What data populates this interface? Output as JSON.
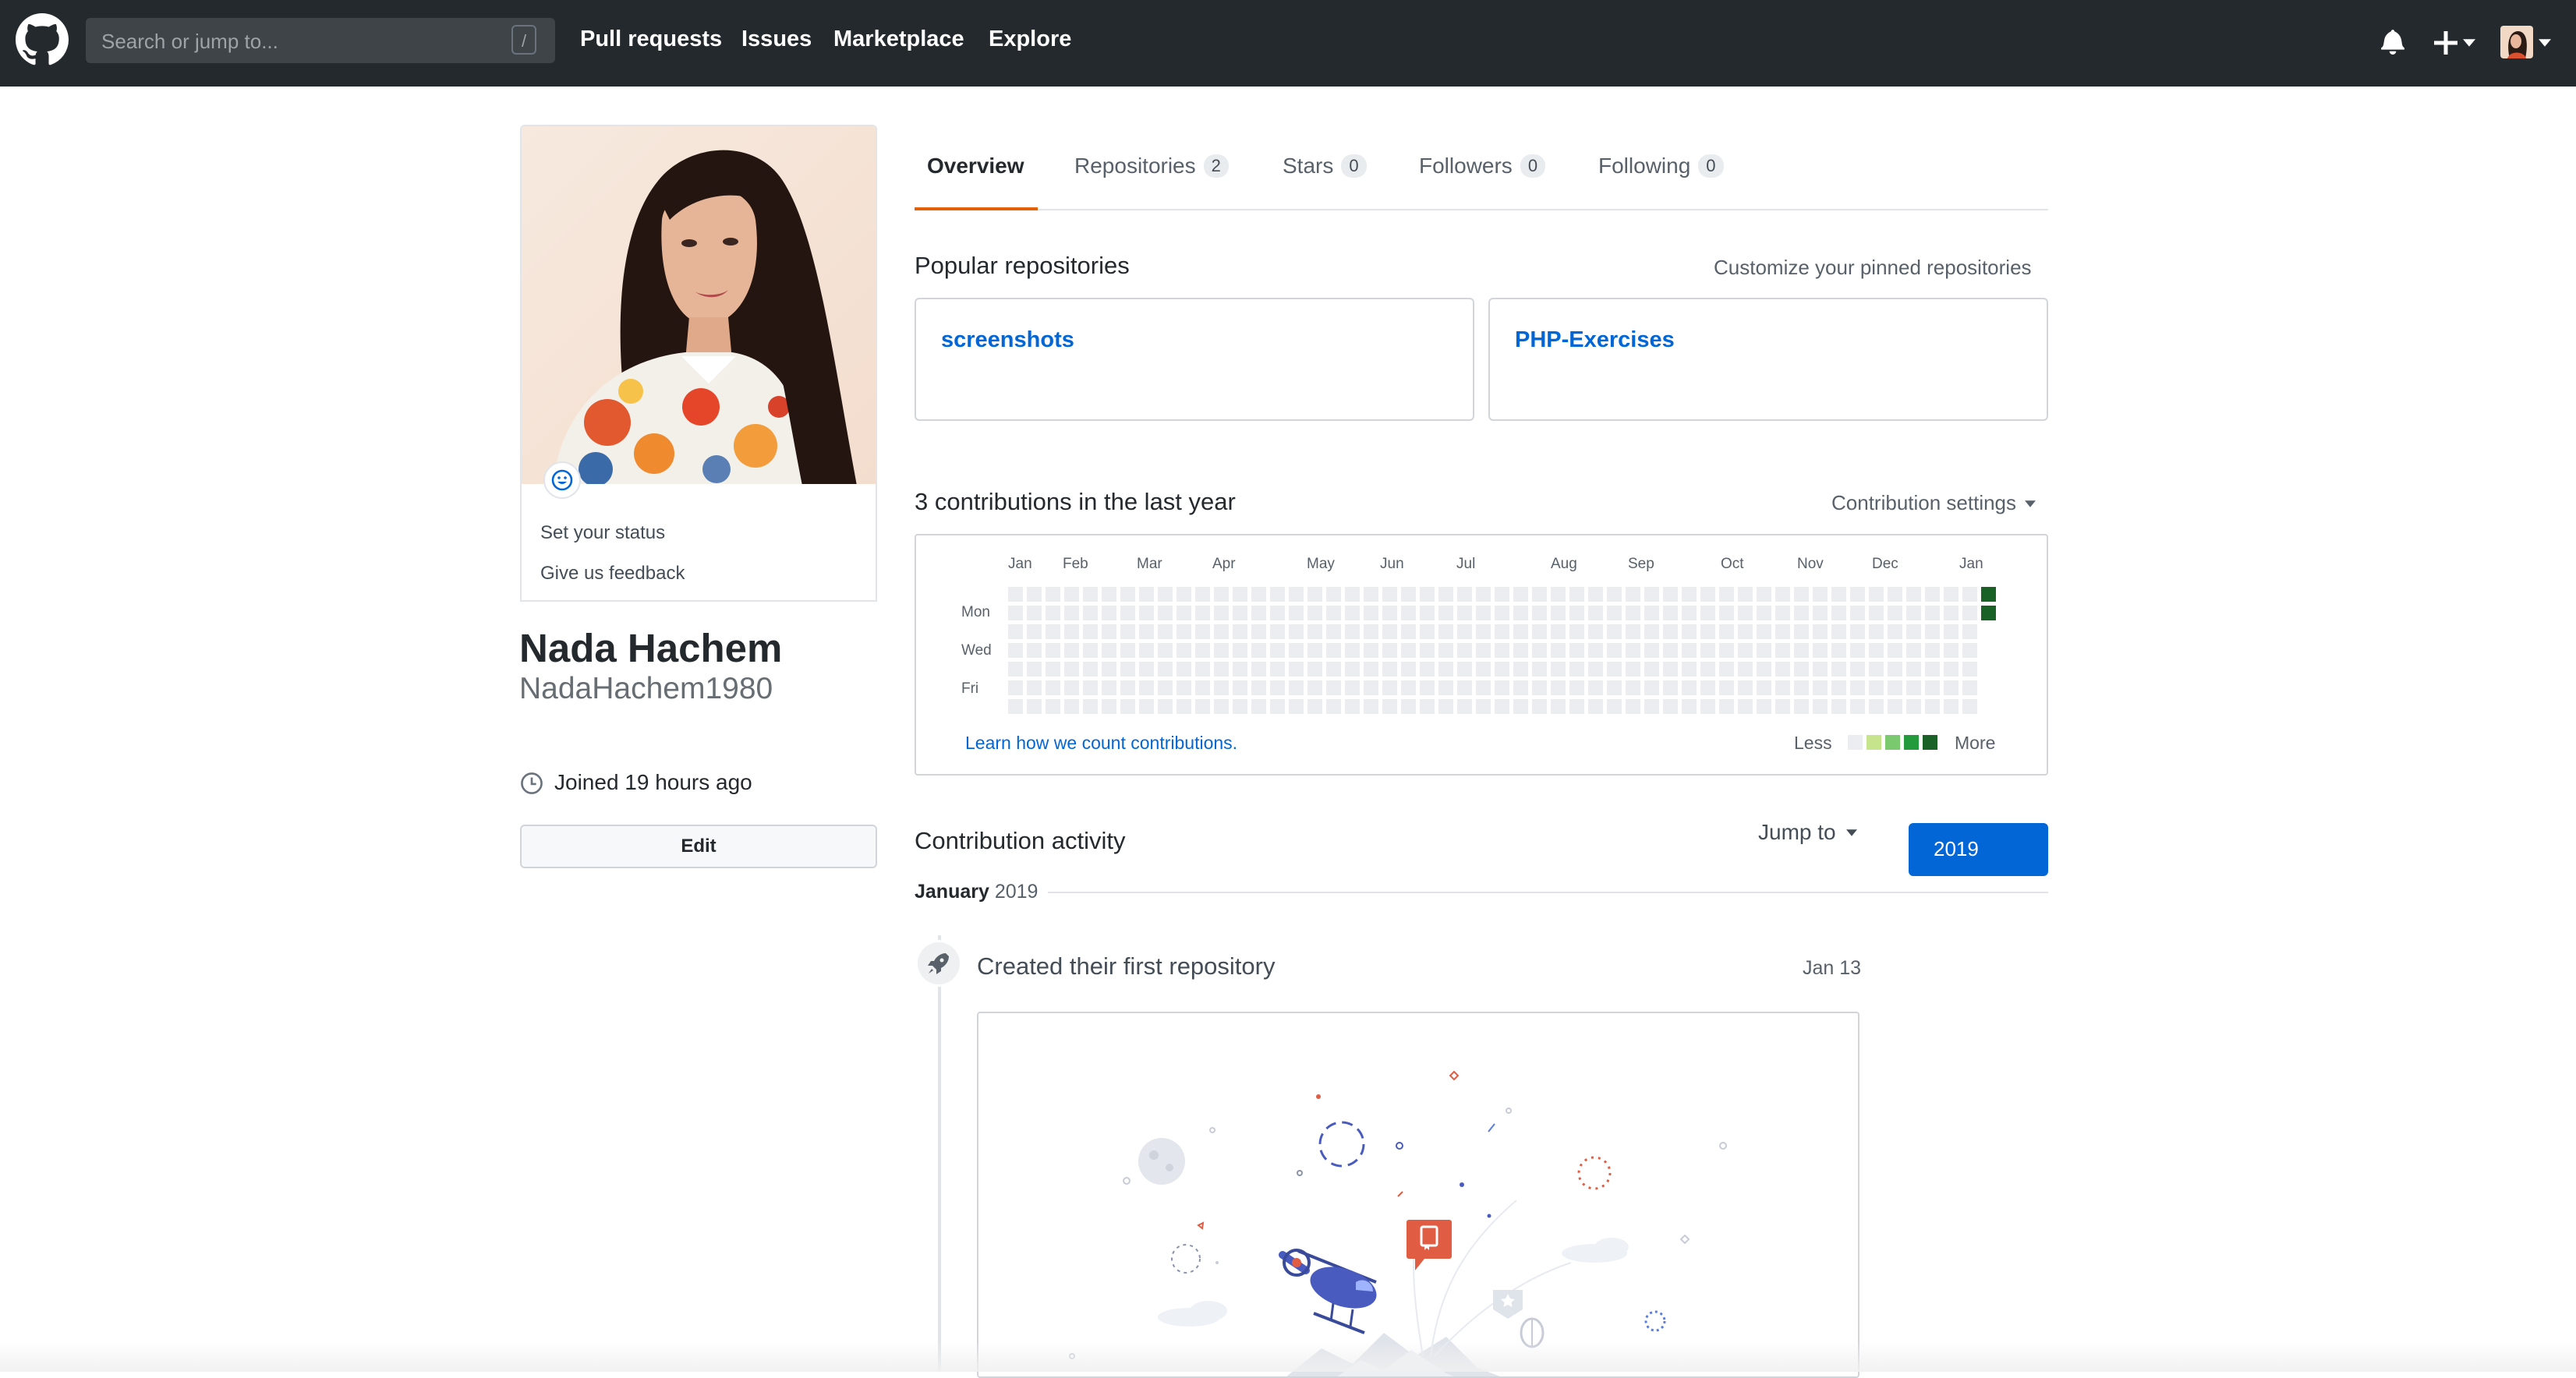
{
  "header": {
    "search_placeholder": "Search or jump to...",
    "search_shortcut": "/",
    "nav": [
      "Pull requests",
      "Issues",
      "Marketplace",
      "Explore"
    ],
    "icons": [
      "github-logo-icon",
      "bell-icon",
      "plus-icon",
      "caret-down-icon",
      "avatar"
    ]
  },
  "sidebar": {
    "status_emoji": "smiley-icon",
    "set_status": "Set your status",
    "give_feedback": "Give us feedback",
    "name": "Nada Hachem",
    "username": "NadaHachem1980",
    "joined": "Joined 19 hours ago",
    "edit_label": "Edit"
  },
  "tabs": [
    {
      "label": "Overview",
      "count": null,
      "selected": true
    },
    {
      "label": "Repositories",
      "count": "2"
    },
    {
      "label": "Stars",
      "count": "0"
    },
    {
      "label": "Followers",
      "count": "0"
    },
    {
      "label": "Following",
      "count": "0"
    }
  ],
  "pinned": {
    "title": "Popular repositories",
    "customize": "Customize your pinned repositories",
    "repos": [
      "screenshots",
      "PHP-Exercises"
    ]
  },
  "contributions": {
    "title": "3 contributions in the last year",
    "settings": "Contribution settings",
    "months": [
      "Jan",
      "Feb",
      "Mar",
      "Apr",
      "May",
      "Jun",
      "Jul",
      "Aug",
      "Sep",
      "Oct",
      "Nov",
      "Dec",
      "Jan"
    ],
    "days": [
      "Mon",
      "Wed",
      "Fri"
    ],
    "weeks": 53,
    "active_days": [
      {
        "week": 52,
        "day": 0,
        "level": 4
      },
      {
        "week": 52,
        "day": 1,
        "level": 4
      }
    ],
    "learn_link": "Learn how we count contributions.",
    "legend_less": "Less",
    "legend_more": "More",
    "legend_colors": [
      "#ebedf0",
      "#c6e48b",
      "#7bc96f",
      "#239a3b",
      "#196127"
    ]
  },
  "activity": {
    "title": "Contribution activity",
    "jump_to": "Jump to",
    "year": "2019",
    "month": "January",
    "month_year": "2019",
    "event": "Created their first repository",
    "event_date": "Jan 13"
  }
}
